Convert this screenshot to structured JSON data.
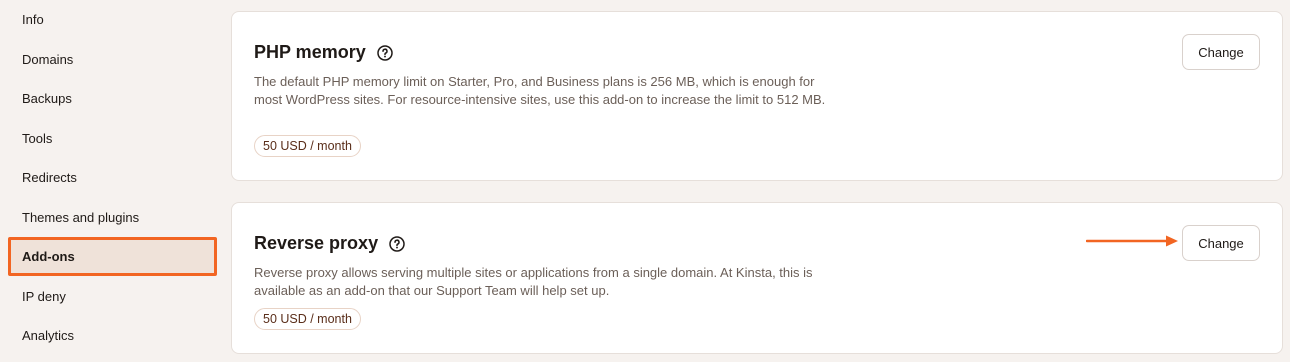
{
  "sidebar": {
    "items": [
      {
        "label": "Info"
      },
      {
        "label": "Domains"
      },
      {
        "label": "Backups"
      },
      {
        "label": "Tools"
      },
      {
        "label": "Redirects"
      },
      {
        "label": "Themes and plugins"
      },
      {
        "label": "Add-ons",
        "active": true
      },
      {
        "label": "IP deny"
      },
      {
        "label": "Analytics"
      }
    ]
  },
  "addons": [
    {
      "title": "PHP memory",
      "description": "The default PHP memory limit on Starter, Pro, and Business plans is 256 MB, which is enough for most WordPress sites. For resource-intensive sites, use this add-on to increase the limit to 512 MB.",
      "price": "50 USD / month",
      "button": "Change"
    },
    {
      "title": "Reverse proxy",
      "description": "Reverse proxy allows serving multiple sites or applications from a single domain. At Kinsta, this is available as an add-on that our Support Team will help set up.",
      "price": "50 USD / month",
      "button": "Change"
    }
  ],
  "icons": {
    "help": "question-circle-icon",
    "arrow": "arrow-right-icon"
  },
  "colors": {
    "accent": "#f26522",
    "background": "#f6f2ef",
    "active_bg": "#efe2d9"
  }
}
